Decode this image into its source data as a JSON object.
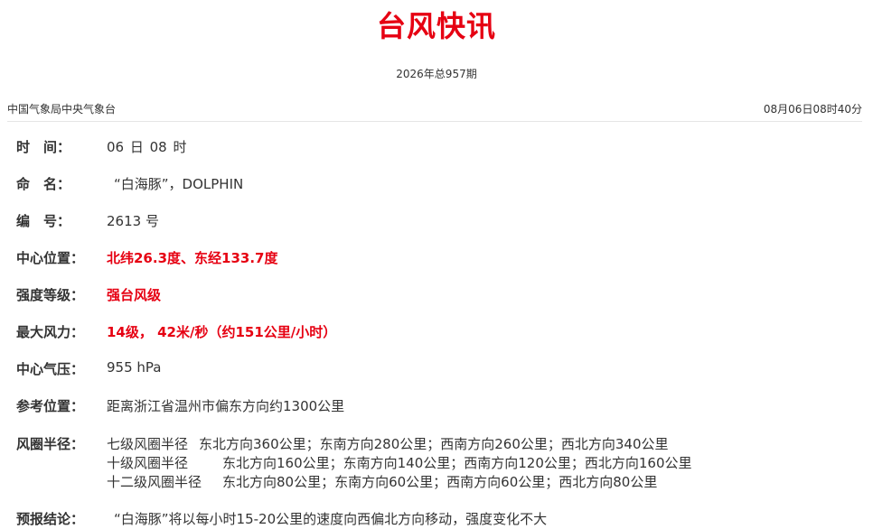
{
  "header": {
    "title": "台风快讯",
    "issue": "2026年总957期",
    "issuer": "中国气象局中央气象台",
    "publish_time": "08月06日08时40分"
  },
  "fields": {
    "time": {
      "label": "时　间：",
      "value": "06 日 08 时"
    },
    "name": {
      "label": "命　名：",
      "value": "“白海豚”，DOLPHIN"
    },
    "number": {
      "label": "编　号：",
      "value": "2613 号"
    },
    "center": {
      "label": "中心位置：",
      "value": "北纬26.3度、东经133.7度"
    },
    "intensity": {
      "label": "强度等级：",
      "value": "强台风级"
    },
    "max_wind": {
      "label": "最大风力：",
      "value": "14级， 42米/秒（约151公里/小时）"
    },
    "pressure": {
      "label": "中心气压：",
      "value": "955 hPa"
    },
    "reference": {
      "label": "参考位置：",
      "value": "距离浙江省温州市偏东方向约1300公里"
    },
    "wind_radii": {
      "label": "风圈半径：",
      "rows": [
        {
          "level": "七级风圈半径",
          "directions": "东北方向360公里；东南方向280公里；西南方向260公里；西北方向340公里"
        },
        {
          "level": "十级风圈半径",
          "directions": "东北方向160公里；东南方向140公里；西南方向120公里；西北方向160公里"
        },
        {
          "level": "十二级风圈半径",
          "directions": "东北方向80公里；东南方向60公里；西南方向60公里；西北方向80公里"
        }
      ]
    },
    "forecast": {
      "label": "预报结论：",
      "value": "“白海豚”将以每小时15-20公里的速度向西偏北方向移动，强度变化不大"
    }
  },
  "colors": {
    "accent_red": "#e60012",
    "text": "#333333",
    "rule": "#e5e5e5"
  }
}
